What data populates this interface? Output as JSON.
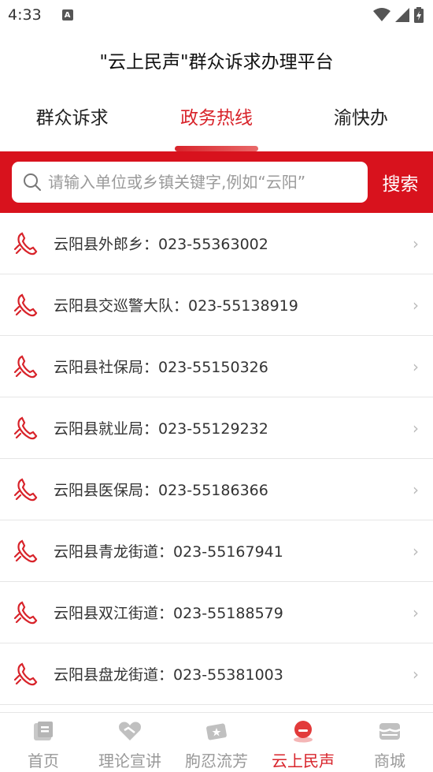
{
  "status": {
    "time": "4:33",
    "notif": "A"
  },
  "header": {
    "title": "\"云上民声\"群众诉求办理平台"
  },
  "tabs": [
    {
      "label": "群众诉求"
    },
    {
      "label": "政务热线"
    },
    {
      "label": "渝快办"
    }
  ],
  "search": {
    "placeholder": "请输入单位或乡镇关键字,例如“云阳”",
    "button": "搜索"
  },
  "hotlines": [
    {
      "label": "云阳县外郎乡：023-55363002"
    },
    {
      "label": "云阳县交巡警大队：023-55138919"
    },
    {
      "label": "云阳县社保局：023-55150326"
    },
    {
      "label": "云阳县就业局：023-55129232"
    },
    {
      "label": "云阳县医保局：023-55186366"
    },
    {
      "label": "云阳县青龙街道：023-55167941"
    },
    {
      "label": "云阳县双江街道：023-55188579"
    },
    {
      "label": "云阳县盘龙街道：023-55381003"
    }
  ],
  "tabbar": [
    {
      "label": "首页",
      "icon": "home-icon"
    },
    {
      "label": "理论宣讲",
      "icon": "handshake-icon"
    },
    {
      "label": "朐忍流芳",
      "icon": "ticket-icon"
    },
    {
      "label": "云上民声",
      "icon": "voice-icon"
    },
    {
      "label": "商城",
      "icon": "shop-icon"
    }
  ],
  "colors": {
    "accent": "#d8232a",
    "band": "#d8121d",
    "inactive": "#999999"
  }
}
